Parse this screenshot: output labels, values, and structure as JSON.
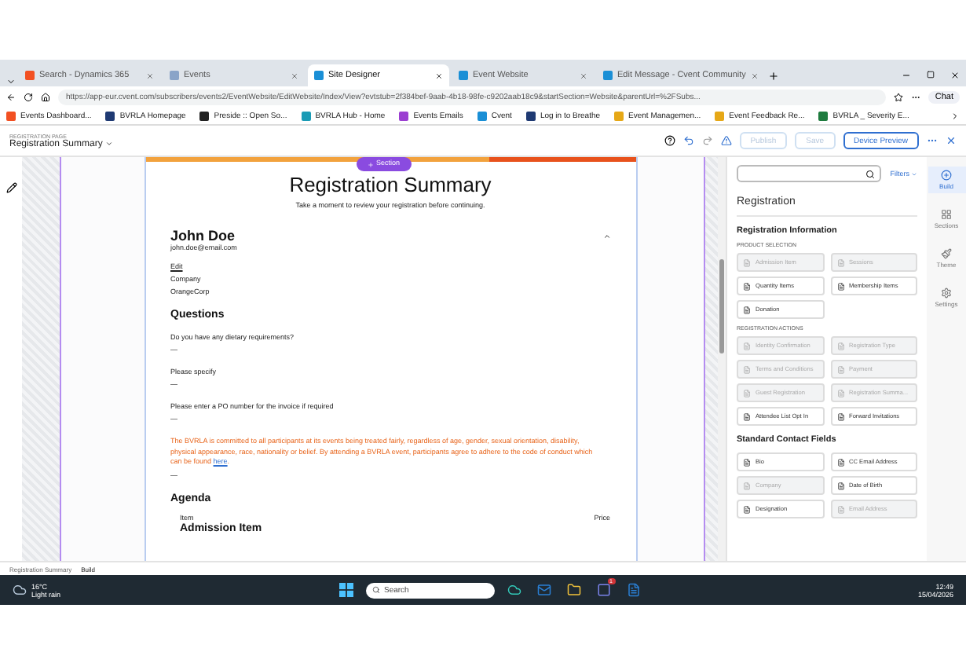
{
  "browser": {
    "tabs": [
      {
        "title": "Search - Dynamics 365",
        "selected": false,
        "color": "#f25022"
      },
      {
        "title": "Events",
        "selected": false,
        "color": "#8aa4c8"
      },
      {
        "title": "Site Designer",
        "selected": true,
        "color": "#1a8fd6"
      },
      {
        "title": "Event Website",
        "selected": false,
        "color": "#1a8fd6"
      },
      {
        "title": "Edit Message - Cvent Community",
        "selected": false,
        "color": "#1a8fd6"
      }
    ],
    "url": "https://app-eur.cvent.com/subscribers/events2/EventWebsite/EditWebsite/Index/View?evtstub=2f384bef-9aab-4b18-98fe-c9202aab18c9&startSection=Website&parentUrl=%2FSubs...",
    "chat": "Chat",
    "bookmarks": [
      {
        "label": "Events Dashboard...",
        "color": "#f25022"
      },
      {
        "label": "BVRLA Homepage",
        "color": "#1f3a73"
      },
      {
        "label": "Preside :: Open So...",
        "color": "#222222"
      },
      {
        "label": "BVRLA Hub - Home",
        "color": "#1a9bb5"
      },
      {
        "label": "Events Emails",
        "color": "#9b3fd1"
      },
      {
        "label": "Cvent",
        "color": "#1a8fd6"
      },
      {
        "label": "Log in to Breathe",
        "color": "#1f3a73"
      },
      {
        "label": "Event Managemen...",
        "color": "#e6a817"
      },
      {
        "label": "Event Feedback Re...",
        "color": "#e6a817"
      },
      {
        "label": "BVRLA _ Severity E...",
        "color": "#1e7b3e"
      }
    ]
  },
  "header": {
    "page_label": "REGISTRATION PAGE",
    "page_name": "Registration Summary",
    "buttons": [
      {
        "label": "Publish",
        "disabled": true
      },
      {
        "label": "Save",
        "disabled": true
      },
      {
        "label": "Device Preview",
        "disabled": false
      }
    ]
  },
  "canvas": {
    "add_section": "Section",
    "title": "Registration Summary",
    "subtitle": "Take a moment to review your registration before continuing.",
    "name": "John Doe",
    "email": "john.doe@email.com",
    "edit": "Edit",
    "field_label": "Company",
    "field_value": "OrangeCorp",
    "questions_heading": "Questions",
    "questions": [
      {
        "question": "Do you have any dietary requirements?",
        "answer": "—"
      },
      {
        "question": "Please specify",
        "answer": "—"
      },
      {
        "question": "Please enter a PO number for the invoice if required",
        "answer": "—"
      }
    ],
    "notice": "The BVRLA is committed to all participants at its events being treated fairly, regardless of age, gender, sexual orientation, disability, physical appearance, race, nationality or belief. By attending a BVRLA event, participants agree to adhere to the code of conduct which can be found ",
    "notice_link": "here",
    "notice_end": ".",
    "notice_answer": "—",
    "agenda_heading": "Agenda",
    "columns": [
      "Item",
      "Price"
    ],
    "agenda_item": "Admission Item"
  },
  "panel": {
    "filters": "Filters",
    "heading": "Registration",
    "sections": [
      {
        "title": "Registration Information",
        "groups": [
          {
            "title": "PRODUCT SELECTION",
            "items": [
              {
                "label": "Admission Item",
                "disabled": true
              },
              {
                "label": "Sessions",
                "disabled": true
              },
              {
                "label": "Quantity Items",
                "disabled": false
              },
              {
                "label": "Membership Items",
                "disabled": false
              },
              {
                "label": "Donation",
                "disabled": false
              }
            ]
          },
          {
            "title": "REGISTRATION ACTIONS",
            "items": [
              {
                "label": "Identity Confirmation",
                "disabled": true
              },
              {
                "label": "Registration Type",
                "disabled": true
              },
              {
                "label": "Terms and Conditions",
                "disabled": true
              },
              {
                "label": "Payment",
                "disabled": true
              },
              {
                "label": "Guest Registration",
                "disabled": true
              },
              {
                "label": "Registration Summa...",
                "disabled": true
              },
              {
                "label": "Attendee List Opt In",
                "disabled": false
              },
              {
                "label": "Forward Invitations",
                "disabled": false
              }
            ]
          }
        ]
      },
      {
        "title": "Standard Contact Fields",
        "groups": [
          {
            "items": [
              {
                "label": "Bio",
                "disabled": false
              },
              {
                "label": "CC Email Address",
                "disabled": false
              },
              {
                "label": "Company",
                "disabled": true
              },
              {
                "label": "Date of Birth",
                "disabled": false
              },
              {
                "label": "Designation",
                "disabled": false
              },
              {
                "label": "Email Address",
                "disabled": true
              }
            ]
          }
        ]
      }
    ]
  },
  "rail": [
    {
      "label": "Build",
      "selected": true,
      "kind": "build"
    },
    {
      "label": "Sections",
      "selected": false,
      "kind": "sections"
    },
    {
      "label": "Theme",
      "selected": false,
      "kind": "theme"
    },
    {
      "label": "Settings",
      "selected": false,
      "kind": "settings"
    }
  ],
  "breadcrumb": [
    "Registration Summary",
    "Build"
  ],
  "taskbar": {
    "temperature": "16°C",
    "weather": "Light rain",
    "search": "Search",
    "notification_count": "1",
    "time": "12:49",
    "date": "15/04/2026"
  }
}
